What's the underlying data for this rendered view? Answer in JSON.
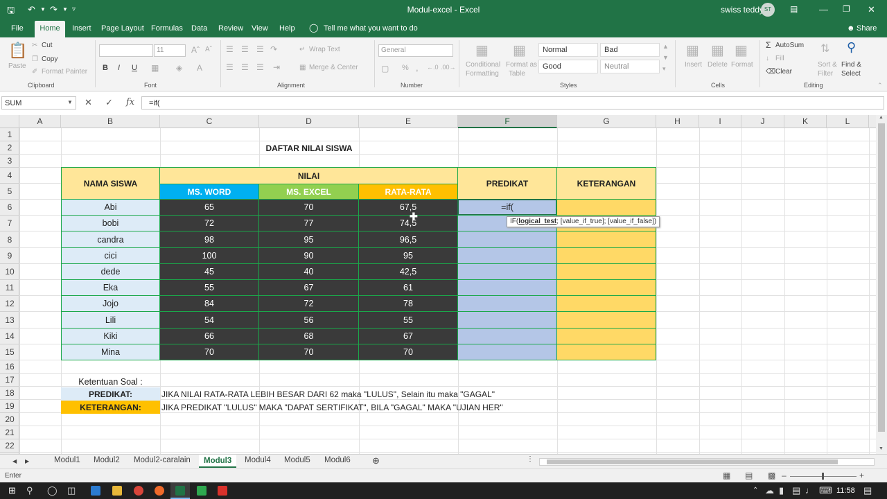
{
  "window": {
    "title": "Modul-excel  -  Excel",
    "user_name": "swiss teddy",
    "user_initials": "ST"
  },
  "ribbon_tabs": [
    "File",
    "Home",
    "Insert",
    "Page Layout",
    "Formulas",
    "Data",
    "Review",
    "View",
    "Help"
  ],
  "tell_me": "Tell me what you want to do",
  "share_label": "Share",
  "clipboard": {
    "paste": "Paste",
    "cut": "Cut",
    "copy": "Copy",
    "format_painter": "Format Painter",
    "group": "Clipboard"
  },
  "font": {
    "size": "11",
    "group": "Font",
    "bold": "B",
    "italic": "I",
    "underline": "U"
  },
  "alignment": {
    "wrap": "Wrap Text",
    "merge": "Merge & Center",
    "group": "Alignment"
  },
  "number": {
    "format": "General",
    "group": "Number",
    "pct": "%",
    "comma": ","
  },
  "styles": {
    "conditional": [
      "Conditional",
      "Formatting"
    ],
    "format_table": [
      "Format as",
      "Table"
    ],
    "normal": "Normal",
    "bad": "Bad",
    "good": "Good",
    "neutral": "Neutral",
    "group": "Styles"
  },
  "cells_group": {
    "insert": "Insert",
    "delete": "Delete",
    "format": "Format",
    "group": "Cells"
  },
  "editing": {
    "autosum": "AutoSum",
    "fill": "Fill",
    "clear": "Clear",
    "sort": [
      "Sort &",
      "Filter"
    ],
    "find": [
      "Find &",
      "Select"
    ],
    "group": "Editing"
  },
  "name_box": "SUM",
  "formula_bar": "=if(",
  "columns": [
    "A",
    "B",
    "C",
    "D",
    "E",
    "F",
    "G",
    "H",
    "I",
    "J",
    "K",
    "L"
  ],
  "selected_column": "F",
  "rows": [
    "1",
    "2",
    "3",
    "4",
    "5",
    "6",
    "7",
    "8",
    "9",
    "10",
    "11",
    "12",
    "13",
    "14",
    "15",
    "16",
    "17",
    "18",
    "19",
    "20",
    "21",
    "22"
  ],
  "sheet": {
    "title": "DAFTAR NILAI SISWA",
    "headers": {
      "name": "NAMA SISWA",
      "nilai": "NILAI",
      "word": "MS. WORD",
      "excel": "MS. EXCEL",
      "avg": "RATA-RATA",
      "predikat": "PREDIKAT",
      "keterangan": "KETERANGAN"
    },
    "students": [
      {
        "name": "Abi",
        "word": "65",
        "excel": "70",
        "avg": "67,5"
      },
      {
        "name": "bobi",
        "word": "72",
        "excel": "77",
        "avg": "74,5"
      },
      {
        "name": "candra",
        "word": "98",
        "excel": "95",
        "avg": "96,5"
      },
      {
        "name": "cici",
        "word": "100",
        "excel": "90",
        "avg": "95"
      },
      {
        "name": "dede",
        "word": "45",
        "excel": "40",
        "avg": "42,5"
      },
      {
        "name": "Eka",
        "word": "55",
        "excel": "67",
        "avg": "61"
      },
      {
        "name": "Jojo",
        "word": "84",
        "excel": "72",
        "avg": "78"
      },
      {
        "name": "Lili",
        "word": "54",
        "excel": "56",
        "avg": "55"
      },
      {
        "name": "Kiki",
        "word": "66",
        "excel": "68",
        "avg": "67"
      },
      {
        "name": "Mina",
        "word": "70",
        "excel": "70",
        "avg": "70"
      }
    ],
    "editing_cell": "=if(",
    "tooltip": {
      "fn": "IF(",
      "arg1": "logical_test",
      "rest": "; [value_if_true]; [value_if_false])"
    },
    "rules_label": "Ketentuan Soal :",
    "rule1_label": "PREDIKAT:",
    "rule1_text": "JIKA NILAI RATA-RATA LEBIH BESAR DARI 62 maka \"LULUS\", Selain itu maka \"GAGAL\"",
    "rule2_label": "KETERANGAN:",
    "rule2_text": "JIKA PREDIKAT \"LULUS\" MAKA \"DAPAT SERTIFIKAT\", BILA \"GAGAL\" MAKA \"UJIAN HER\""
  },
  "sheet_tabs": [
    "Modul1",
    "Modul2",
    "Modul2-caralain",
    "Modul3",
    "Modul4",
    "Modul5",
    "Modul6"
  ],
  "active_sheet": "Modul3",
  "status": {
    "mode": "Enter"
  },
  "clock": "11:58",
  "colors": {
    "excel_green": "#217346",
    "dark_fill": "#3a3a3a",
    "light_blue": "#ddebf7",
    "yellow": "#ffe699",
    "word_blue": "#00b0f0",
    "excel_green_fill": "#92d050",
    "orange": "#ffc000",
    "predikat_fill": "#b4c6e7",
    "keterangan_fill": "#ffd966",
    "border_green": "#1aa84a"
  }
}
